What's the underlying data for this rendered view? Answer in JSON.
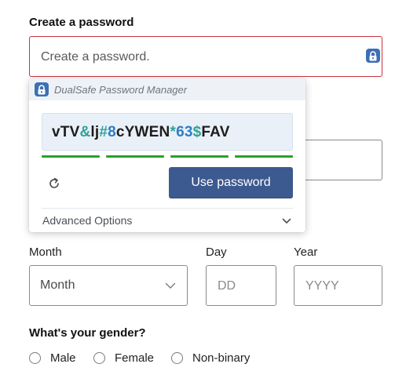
{
  "password": {
    "label": "Create a password",
    "placeholder": "Create a password.",
    "icon": "dualsafe-lock-icon"
  },
  "popup": {
    "title": "DualSafe Password Manager",
    "generated_password_parts": [
      {
        "text": "vTV",
        "kind": "letter"
      },
      {
        "text": "&",
        "kind": "symbol"
      },
      {
        "text": "lj",
        "kind": "letter"
      },
      {
        "text": "#",
        "kind": "symbol"
      },
      {
        "text": "8",
        "kind": "number"
      },
      {
        "text": "cYWEN",
        "kind": "letter"
      },
      {
        "text": "*",
        "kind": "symbol"
      },
      {
        "text": "63",
        "kind": "number"
      },
      {
        "text": "$",
        "kind": "symbol"
      },
      {
        "text": "FAV",
        "kind": "letter"
      }
    ],
    "strength_bars": 4,
    "strength_color": "#2aa12a",
    "use_password_label": "Use password",
    "advanced_options_label": "Advanced Options",
    "refresh_icon": "refresh-icon"
  },
  "birthdate": {
    "month_label": "Month",
    "month_value": "Month",
    "day_label": "Day",
    "day_placeholder": "DD",
    "year_label": "Year",
    "year_placeholder": "YYYY"
  },
  "gender": {
    "label": "What's your gender?",
    "options": [
      "Male",
      "Female",
      "Non-binary"
    ]
  },
  "colors": {
    "error_border": "#c8323a",
    "primary_button": "#3c5a8f",
    "brand_lock": "#3c6fb6"
  }
}
